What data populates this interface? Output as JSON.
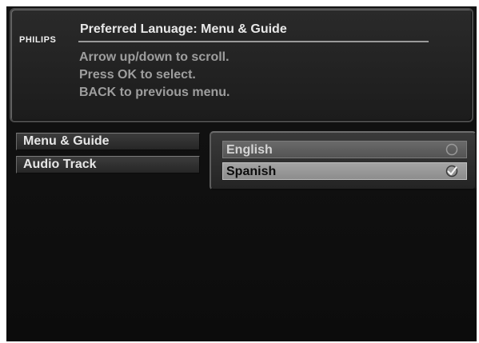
{
  "header": {
    "logo": "PHILIPS",
    "title": "Preferred Lanuage: Menu & Guide",
    "instructions": [
      "Arrow up/down to scroll.",
      "Press OK to select.",
      "BACK to previous menu."
    ]
  },
  "sidebar": {
    "tabs": [
      {
        "label": "Menu & Guide"
      },
      {
        "label": "Audio Track"
      }
    ]
  },
  "options": {
    "items": [
      {
        "label": "English",
        "selected": false,
        "icon": "radio-empty-icon"
      },
      {
        "label": "Spanish",
        "selected": true,
        "icon": "checkmark-icon"
      }
    ]
  },
  "colors": {
    "background": "#111111",
    "highlight": "#9a9a9a",
    "text": "#e6e6e6"
  }
}
